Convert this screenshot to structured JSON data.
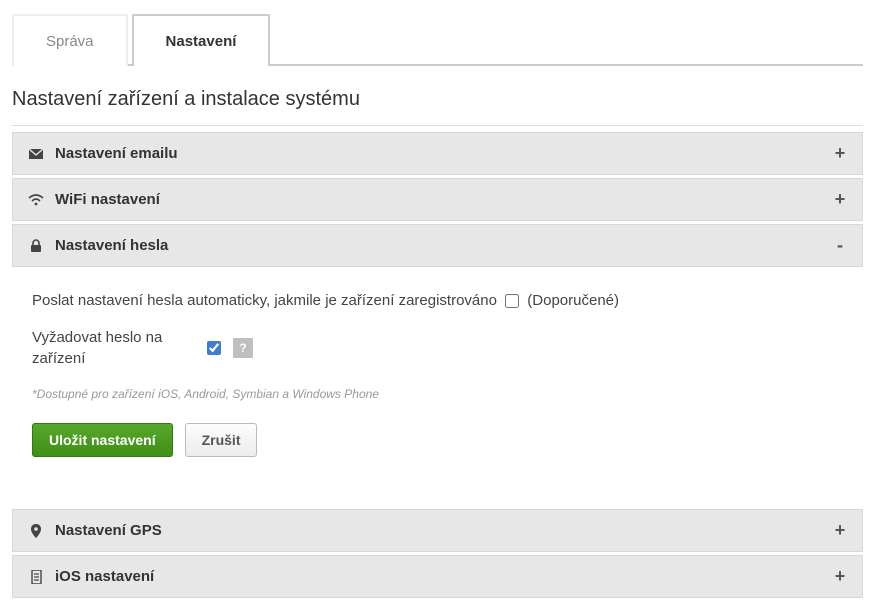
{
  "tabs": {
    "admin": "Správa",
    "settings": "Nastavení"
  },
  "page_title": "Nastavení zařízení a instalace systému",
  "sections": {
    "email": {
      "title": "Nastavení emailu",
      "toggle": "+"
    },
    "wifi": {
      "title": "WiFi nastavení",
      "toggle": "+"
    },
    "password": {
      "title": "Nastavení hesla",
      "toggle": "-"
    },
    "gps": {
      "title": "Nastavení GPS",
      "toggle": "+"
    },
    "ios": {
      "title": "iOS nastavení",
      "toggle": "+"
    }
  },
  "password_panel": {
    "auto_send_label": "Poslat nastavení hesla automaticky, jakmile je zařízení zaregistrováno",
    "auto_send_recommended": "(Doporučené)",
    "require_label": "Vyžadovat heslo na zařízení",
    "help_symbol": "?",
    "note": "*Dostupné pro zařízení iOS, Android, Symbian a Windows Phone",
    "save_label": "Uložit nastavení",
    "cancel_label": "Zrušit"
  }
}
